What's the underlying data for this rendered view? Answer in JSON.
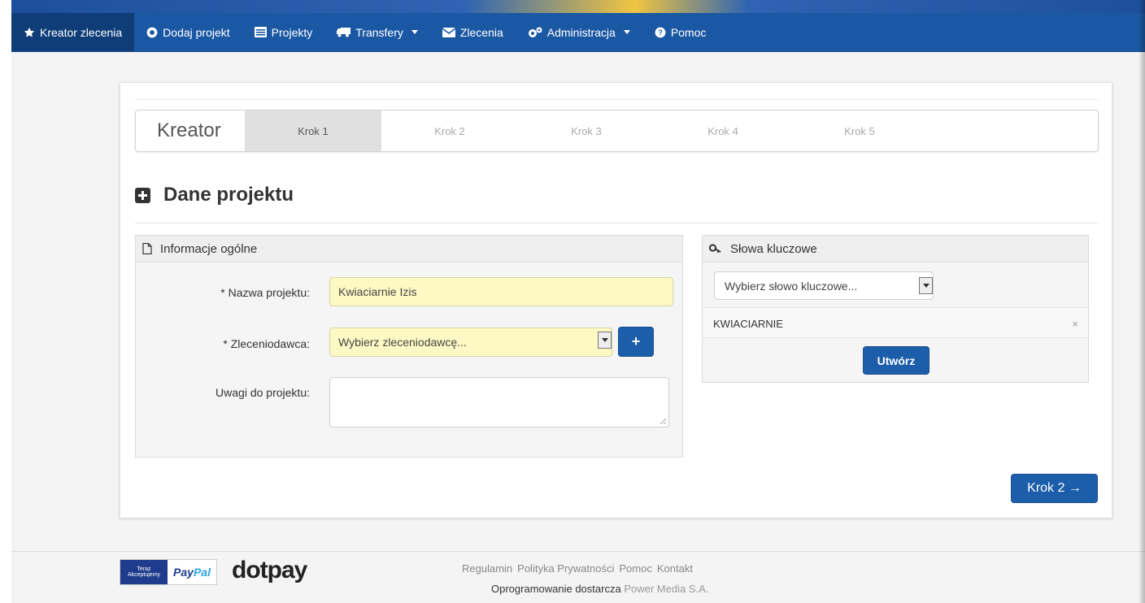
{
  "navbar": {
    "items": [
      {
        "label": "Kreator zlecenia",
        "icon": "star-icon",
        "active": true
      },
      {
        "label": "Dodaj projekt",
        "icon": "plus-circle-icon"
      },
      {
        "label": "Projekty",
        "icon": "list-icon"
      },
      {
        "label": "Transfery",
        "icon": "truck-icon",
        "dropdown": true
      },
      {
        "label": "Zlecenia",
        "icon": "envelope-icon"
      },
      {
        "label": "Administracja",
        "icon": "gears-icon",
        "dropdown": true
      },
      {
        "label": "Pomoc",
        "icon": "question-circle-icon"
      }
    ]
  },
  "wizard": {
    "title": "Kreator",
    "steps": [
      "Krok 1",
      "Krok 2",
      "Krok 3",
      "Krok 4",
      "Krok 5"
    ],
    "active_step": "Krok 1"
  },
  "section": {
    "title": "Dane projektu"
  },
  "info_panel": {
    "title": "Informacje ogólne",
    "project_name_label": "* Nazwa projektu:",
    "project_name_value": "Kwiaciarnie Izis",
    "client_label": "* Zleceniodawca:",
    "client_placeholder": "Wybierz zleceniodawcę...",
    "add_client_label": "+",
    "notes_label": "Uwagi do projektu:",
    "notes_value": ""
  },
  "keywords_panel": {
    "title": "Słowa kluczowe",
    "select_placeholder": "Wybierz słowo kluczowe...",
    "keywords": [
      "KWIACIARNIE"
    ],
    "remove_label": "×",
    "create_label": "Utwórz"
  },
  "next_button": {
    "label": "Krok 2 →"
  },
  "footer": {
    "badge_top": "Teraz",
    "badge_bottom": "Akceptujemy",
    "paypal_a": "Pay",
    "paypal_b": "Pal",
    "dotpay": "dotpay",
    "links": [
      "Regulamin",
      "Polityka Prywatności",
      "Pomoc",
      "Kontakt"
    ],
    "credit_prefix": "Oprogramowanie dostarcza",
    "credit_vendor": "Power Media S.A."
  },
  "colors": {
    "navbar": "#1b58a4",
    "navbar_active": "#0e3d78",
    "primary_button": "#1c5ea9",
    "required_input": "#fdf9c4"
  }
}
